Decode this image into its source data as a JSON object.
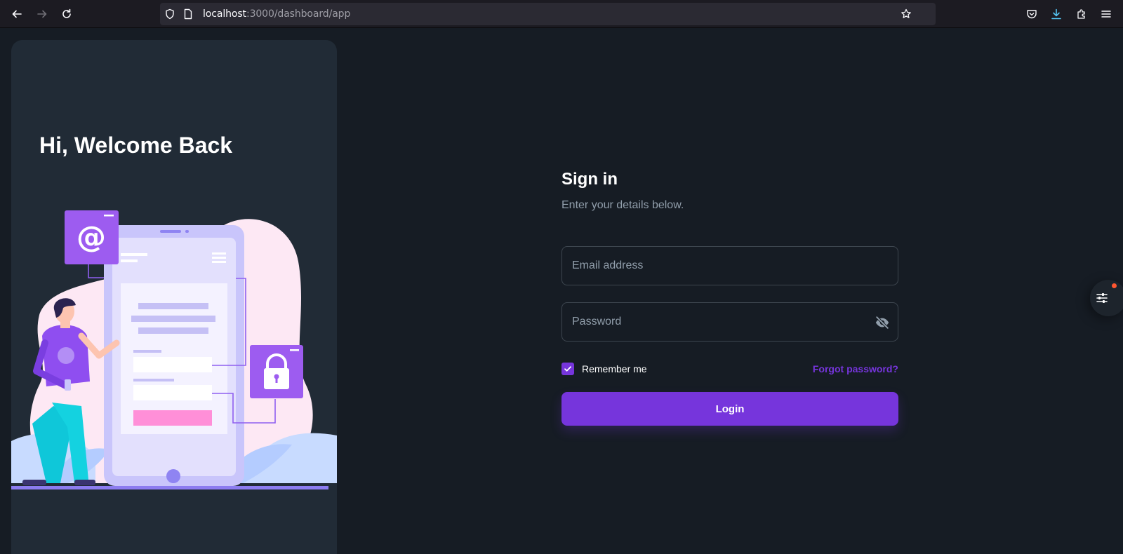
{
  "browser": {
    "url_host": "localhost",
    "url_path": ":3000/dashboard/app"
  },
  "hero": {
    "title": "Hi, Welcome Back"
  },
  "form": {
    "title": "Sign in",
    "subtitle": "Enter your details below.",
    "email_placeholder": "Email address",
    "email_value": "",
    "password_placeholder": "Password",
    "password_value": "",
    "remember_label": "Remember me",
    "remember_checked": true,
    "forgot_label": "Forgot password?",
    "login_label": "Login"
  },
  "colors": {
    "primary": "#7635dc",
    "background": "#161c24",
    "panel": "#212b36",
    "secondary_text": "#919eab",
    "notification_dot": "#ff5630"
  },
  "icons": {
    "back": "arrow-left",
    "forward": "arrow-right",
    "reload": "reload",
    "tracking_shield": "shield",
    "page": "page",
    "bookmark": "star",
    "pocket": "pocket",
    "downloads": "download-arrow",
    "extensions": "puzzle",
    "menu": "hamburger",
    "password_toggle": "eye-off",
    "checkbox": "checkmark",
    "settings": "sliders"
  }
}
